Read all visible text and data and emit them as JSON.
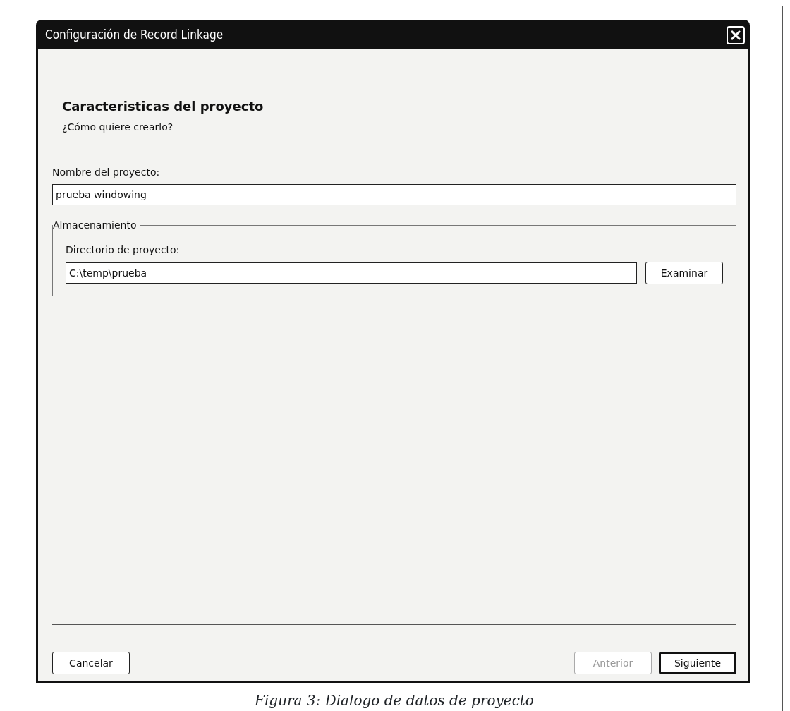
{
  "window": {
    "title": "Configuración de Record Linkage"
  },
  "header": {
    "title": "Caracteristicas del proyecto",
    "subtitle": "¿Cómo quiere crearlo?"
  },
  "project_name": {
    "label": "Nombre del proyecto:",
    "value": "prueba windowing"
  },
  "storage": {
    "title": "Almacenamiento",
    "label": "Directorio de proyecto:",
    "value": "C:\\temp\\prueba",
    "browse": "Examinar"
  },
  "left_buttons": [
    {
      "label": "Cancelar",
      "disabled": false,
      "default": false
    }
  ],
  "right_buttons": [
    {
      "label": "Anterior",
      "disabled": true,
      "default": false
    },
    {
      "label": "Siguiente",
      "disabled": false,
      "default": true
    }
  ],
  "caption": "Figura 3: Dialogo de datos de proyecto"
}
